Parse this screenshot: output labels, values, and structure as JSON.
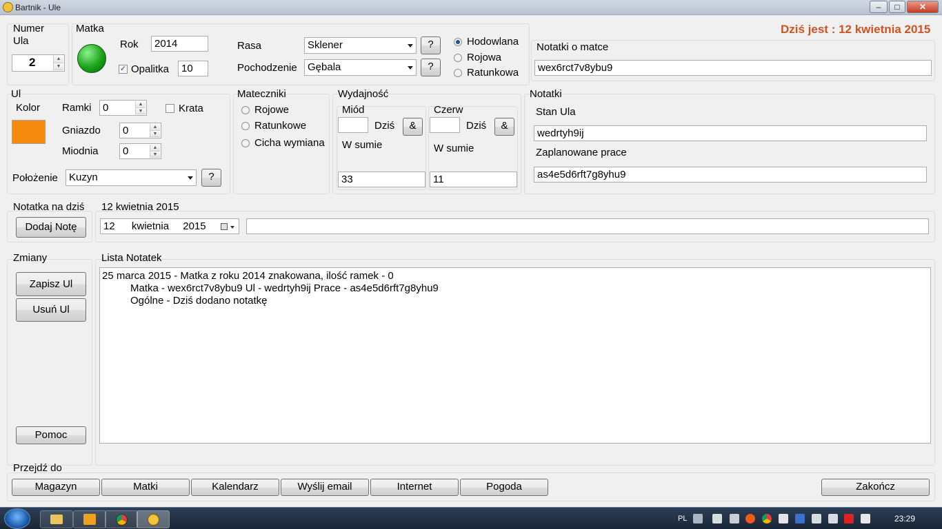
{
  "window": {
    "title": "Bartnik - Ule"
  },
  "header": {
    "today": "Dziś jest : 12 kwietnia 2015"
  },
  "hive": {
    "group_label": "Numer Ula",
    "number": "2"
  },
  "queen": {
    "group_label": "Matka",
    "year_label": "Rok",
    "year": "2014",
    "opalitka_label": "Opalitka",
    "opalitka_value": "10",
    "breed_label": "Rasa",
    "breed": "Sklener",
    "origin_label": "Pochodzenie",
    "origin": "Gębala",
    "help": "?",
    "types": [
      "Hodowlana",
      "Rojowa",
      "Ratunkowa"
    ],
    "notes_label": "Notatki o matce",
    "notes": "wex6rct7v8ybu9",
    "status_color": "#1aa31a"
  },
  "ul": {
    "group_label": "Ul",
    "color_label": "Kolor",
    "color": "#f58a0e",
    "frames_label": "Ramki",
    "frames": "0",
    "grate_label": "Krata",
    "nest_label": "Gniazdo",
    "nest": "0",
    "honey_chamber_label": "Miodnia",
    "honey_chamber": "0",
    "location_label": "Położenie",
    "location": "Kuzyn"
  },
  "queen_cells": {
    "group_label": "Mateczniki",
    "options": [
      "Rojowe",
      "Ratunkowe",
      "Cicha wymiana"
    ]
  },
  "yield": {
    "group_label": "Wydajność",
    "honey_label": "Miód",
    "brood_label": "Czerw",
    "today_label": "Dziś",
    "amp": "&",
    "total_label": "W sumie",
    "honey_total": "33",
    "brood_total": "11"
  },
  "notes": {
    "group_label": "Notatki",
    "state_label": "Stan Ula",
    "state": "wedrtyh9ij",
    "planned_label": "Zaplanowane prace",
    "planned": "as4e5d6rft7g8yhu9"
  },
  "note_today": {
    "group_label": "Notatka na dziś",
    "add_button": "Dodaj Notę",
    "date_label": "12 kwietnia 2015",
    "day": "12",
    "month": "kwietnia",
    "year": "2015"
  },
  "changes": {
    "group_label": "Zmiany",
    "save": "Zapisz Ul",
    "delete": "Usuń Ul",
    "help": "Pomoc"
  },
  "note_list": {
    "group_label": "Lista Notatek",
    "lines": [
      "25 marca 2015 - Matka z roku 2014 znakowana, ilość ramek - 0",
      "Matka - wex6rct7v8ybu9 Ul - wedrtyh9ij Prace - as4e5d6rft7g8yhu9",
      "Ogólne - Dziś dodano notatkę"
    ]
  },
  "goto": {
    "group_label": "Przejdź do",
    "buttons": [
      "Magazyn",
      "Matki",
      "Kalendarz",
      "Wyślij email",
      "Internet",
      "Pogoda"
    ],
    "exit": "Zakończ"
  },
  "taskbar": {
    "lang": "PL",
    "clock": "23:29"
  }
}
